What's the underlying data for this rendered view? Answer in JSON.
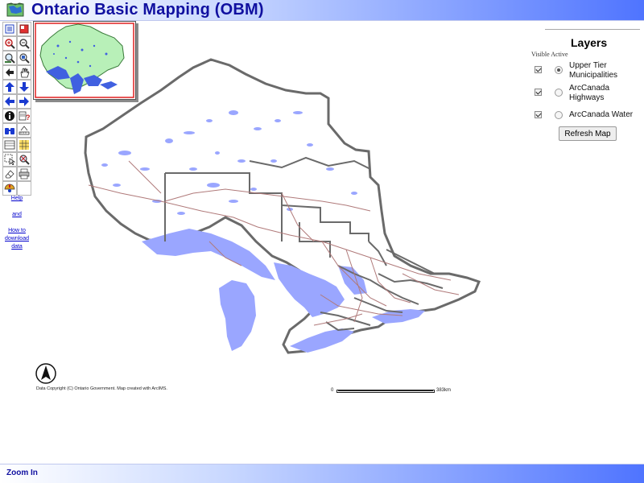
{
  "header": {
    "title": "Ontario Basic Mapping (OBM)",
    "logo_icon": "map-logo-icon"
  },
  "toolbar": {
    "tools": [
      [
        "toggle-legend-icon",
        "toggle-overview-icon"
      ],
      [
        "zoom-in-icon",
        "zoom-out-icon"
      ],
      [
        "zoom-full-icon",
        "zoom-active-layer-icon"
      ],
      [
        "zoom-previous-icon",
        "pan-icon"
      ],
      [
        "pan-north-icon",
        "pan-south-icon"
      ],
      [
        "pan-west-icon",
        "pan-east-icon"
      ],
      [
        "identify-icon",
        "query-icon"
      ],
      [
        "find-icon",
        "measure-icon"
      ],
      [
        "select-rectangle-icon",
        "buffer-icon"
      ],
      [
        "select-shape-icon",
        "clear-selection-icon"
      ],
      [
        "eraser-icon",
        "print-icon"
      ],
      [
        "options-icon",
        ""
      ]
    ]
  },
  "help_links": [
    "Help",
    "and",
    "How to",
    "download",
    "data"
  ],
  "layers_panel": {
    "title": "Layers",
    "subheader": "Visible Active",
    "layers": [
      {
        "name": "Upper Tier Municipalities",
        "visible": true,
        "active": true
      },
      {
        "name": "ArcCanada Highways",
        "visible": true,
        "active": false
      },
      {
        "name": "ArcCanada Water",
        "visible": true,
        "active": false
      }
    ],
    "refresh_label": "Refresh Map"
  },
  "map": {
    "copyright": "Data Copyright (C) Ontario Government.  Map created with ArcIMS.",
    "scale_start": "0",
    "scale_end": "383km",
    "colors": {
      "water": "#9aa6ff",
      "boundary": "#666666",
      "roads": "#b07a7a",
      "land": "#ffffff",
      "overview_land": "#b8f0b8"
    }
  },
  "footer": {
    "status": "Zoom In"
  }
}
